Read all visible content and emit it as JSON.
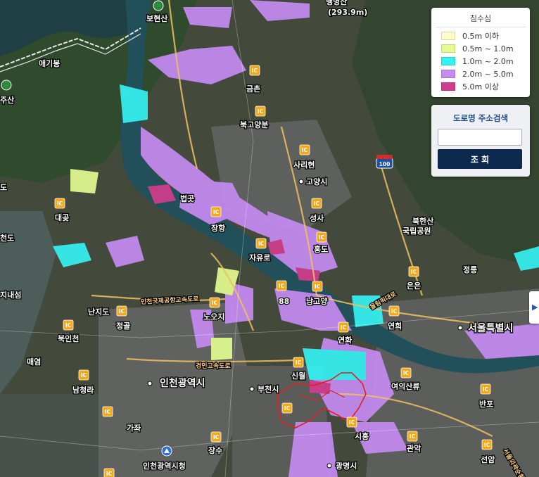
{
  "map": {
    "places": {
      "bohyeonsan": "보현산",
      "aegibong": "애기봉",
      "jusan": "주산",
      "do": "도",
      "daegot": "대곶",
      "chado": "천도",
      "jinaeseom": "지내섬",
      "nanjido": "난지도",
      "jeonggol": "정골",
      "bukinchon": "북인천",
      "maeyeom": "매염",
      "namcheongna": "남청라",
      "gajwa": "가좌",
      "incheon_city": "인천광역시",
      "incheon_cityhall": "인천광역시청",
      "jangsu": "장수",
      "bucheon": "부천시",
      "sinwol": "신월",
      "gwangmyeong": "광명시",
      "siheung": "시흥",
      "gwanak": "관악",
      "seonam": "선암",
      "yeouido": "여의산류",
      "banpo": "반포",
      "seoul": "서울특별시",
      "yeonhui": "연희",
      "eungam": "은은",
      "jeongneung": "정릉",
      "bukhansan": "북한산\n국립공원",
      "bukhansan_l1": "북한산",
      "bukhansan_l2": "국립공원",
      "goyang": "고양시",
      "saridan": "사리현",
      "seongsa": "성사",
      "hwado": "홍도",
      "jayuro": "자유로",
      "namgoyang": "남고양",
      "gimpo_88": "88",
      "ojeong": "노오지",
      "janghang": "장항",
      "beopgot": "법곳",
      "bukgoyang": "북고양분",
      "geumchon": "금촌",
      "peak_name": "(293.9m)",
      "hwamyeong": "행명산",
      "yeonhwa": "연화"
    },
    "roads": {
      "incheon_airport_exp": "인천국제공항고속도로",
      "gyeongin": "경인고속도로",
      "olympic": "올림픽대로",
      "seoul_ring": "서울외곽순환",
      "route100": "100"
    },
    "ic_label": "IC"
  },
  "legend": {
    "title": "침수심",
    "items": [
      {
        "label": "0.5m 이하",
        "color": "#fffac8"
      },
      {
        "label": "0.5m ~ 1.0m",
        "color": "#e3fb91"
      },
      {
        "label": "1.0m ~ 2.0m",
        "color": "#35f2f2"
      },
      {
        "label": "2.0m ~ 5.0m",
        "color": "#c68bf2"
      },
      {
        "label": "5.0m 이상",
        "color": "#d23c8e"
      }
    ]
  },
  "search": {
    "title": "도로명 주소검색",
    "input_value": "",
    "placeholder": "",
    "button_label": "조 회"
  },
  "side_toggle": {
    "icon": "chevron-right-icon"
  }
}
